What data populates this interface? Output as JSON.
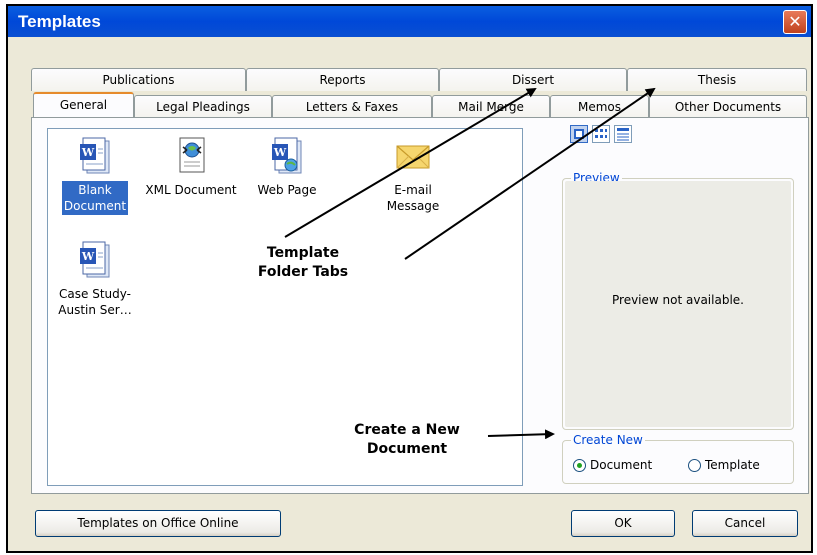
{
  "window": {
    "title": "Templates",
    "close_glyph": "✕"
  },
  "tabs_back": [
    "Publications",
    "Reports",
    "Dissert",
    "Thesis"
  ],
  "tabs_front": [
    "General",
    "Legal Pleadings",
    "Letters & Faxes",
    "Mail Merge",
    "Memos",
    "Other Documents"
  ],
  "active_tab": "General",
  "templates": [
    {
      "label": "Blank Document",
      "label_lines": [
        "Blank",
        "Document"
      ],
      "icon": "word-document-icon",
      "selected": true
    },
    {
      "label": "XML Document",
      "label_lines": [
        "XML Document"
      ],
      "icon": "xml-document-icon",
      "selected": false
    },
    {
      "label": "Web Page",
      "label_lines": [
        "Web Page"
      ],
      "icon": "web-page-icon",
      "selected": false
    },
    {
      "label": "E-mail Message",
      "label_lines": [
        "E-mail",
        "Message"
      ],
      "icon": "envelope-icon",
      "selected": false
    },
    {
      "label": "Case Study-Austin Ser...",
      "label_lines": [
        "Case Study-",
        "Austin Ser…"
      ],
      "icon": "word-document-icon",
      "selected": false
    }
  ],
  "view_buttons": [
    "large-icons-view-icon",
    "list-view-icon",
    "details-view-icon"
  ],
  "preview": {
    "legend": "Preview",
    "message": "Preview not available."
  },
  "create_new": {
    "legend": "Create New",
    "options": [
      "Document",
      "Template"
    ],
    "selected": "Document"
  },
  "buttons": {
    "online": "Templates on Office Online",
    "ok": "OK",
    "cancel": "Cancel"
  },
  "annotations": {
    "tabs_note_lines": [
      "Template",
      "Folder Tabs"
    ],
    "create_note_lines": [
      "Create a New",
      "Document"
    ]
  },
  "colors": {
    "titlebar": "#0a5fe0",
    "selection": "#316ac5",
    "legend_text": "#0046d5",
    "dialog_face": "#ece9d8"
  }
}
